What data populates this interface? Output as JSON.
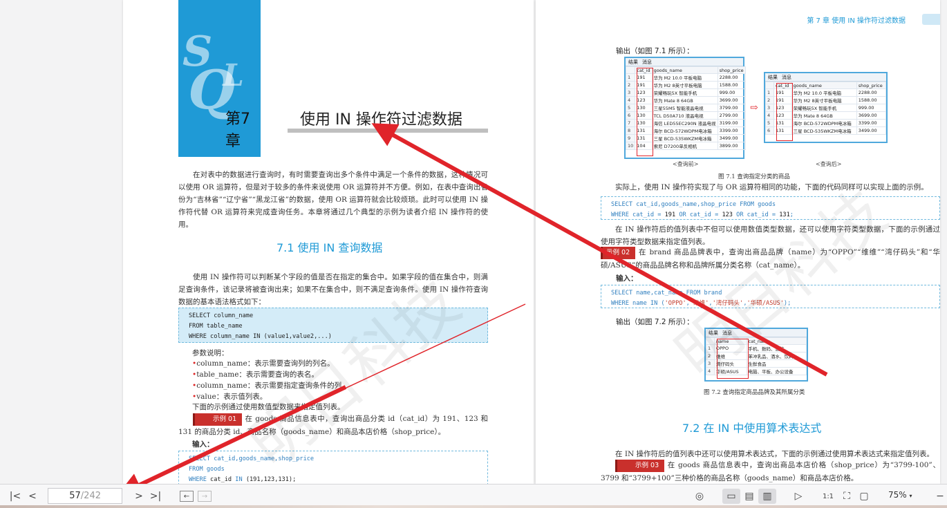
{
  "left_page": {
    "chapter_number": "第7章",
    "sql_letters": {
      "s": "S",
      "q": "Q",
      "l": "L"
    },
    "chapter_title": "使用 IN 操作符过滤数据",
    "intro": "在对表中的数据进行查询时，有时需要查询出多个条件中满足一个条件的数据，这种情况可以使用 OR 运算符，但是对于较多的条件来说使用 OR 运算符并不方便。例如，在表中查询出省份为“吉林省”“辽宁省”“黑龙江省”的数据，使用 OR 运算符就会比较烦琐。此时可以使用 IN 操作符代替 OR 运算符来完成查询任务。本章将通过几个典型的示例为读者介绍 IN 操作符的使用。",
    "section_title": "7.1  使用 IN 查询数据",
    "section_para": "使用 IN 操作符可以判断某个字段的值是否在指定的集合中。如果字段的值在集合中，则满足查询条件，该记录将被查询出来；如果不在集合中，则不满足查询条件。使用 IN 操作符查询数据的基本语法格式如下：",
    "syntax": [
      "SELECT column_name",
      "FROM table_name",
      "WHERE column_name IN (value1,value2,...)"
    ],
    "params_label": "参数说明：",
    "params": [
      "column_name：表示需要查询列的列名。",
      "table_name：表示需要查询的表名。",
      "column_name：表示需要指定查询条件的列。",
      "value：表示值列表。"
    ],
    "example_intro": "下面的示例通过使用数值型数据来指定值列表。",
    "example_tag": "示例 01",
    "example_text": "在 goods 商品信息表中，查询出商品分类 id（cat_id）为 191、123 和 131 的商品分类 id、商品名称（goods_name）和商品本店价格（shop_price）。",
    "input_label": "输入：",
    "code": {
      "l1_kw": "SELECT",
      "l1": " cat_id,goods_name,shop_price",
      "l2_kw": "FROM",
      "l2": " goods",
      "l3_kw": "WHERE",
      "l3a": " cat_id ",
      "l3_in": "IN",
      "l3b": " (191,123,131);"
    }
  },
  "right_page": {
    "running_head": "第 7 章    使用 IN 操作符过滤数据",
    "output_label_1": "输出（如图 7.1 所示）：",
    "tab_result": "结果",
    "tab_message": "消息",
    "table_before": {
      "headers": [
        "cat_id",
        "goods_name",
        "shop_price"
      ],
      "rows": [
        [
          "1",
          "191",
          "华为 M2 10.0 平板电脑",
          "2288.00"
        ],
        [
          "2",
          "191",
          "华为 M2 8英寸平板电脑",
          "1588.00"
        ],
        [
          "3",
          "123",
          "荣耀畅玩5X 智能手机",
          "999.00"
        ],
        [
          "4",
          "123",
          "华为 Mate 8 64GB",
          "3699.00"
        ],
        [
          "5",
          "130",
          "三星55M5 智能液晶电视",
          "3799.00"
        ],
        [
          "6",
          "130",
          "TCL D50A710 液晶电视",
          "2799.00"
        ],
        [
          "7",
          "130",
          "海信 LED55EC290N 液晶电视",
          "3199.00"
        ],
        [
          "8",
          "131",
          "海尔 BCD-572WDPM电冰箱",
          "3399.00"
        ],
        [
          "9",
          "131",
          "三星 BCD-535WKZM电冰箱",
          "3499.00"
        ],
        [
          "10",
          "104",
          "索尼 D7200单反相机",
          "3899.00"
        ]
      ]
    },
    "table_after": {
      "headers": [
        "cat_id",
        "goods_name",
        "shop_price"
      ],
      "rows": [
        [
          "1",
          "191",
          "华为 M2 10.0 平板电脑",
          "2288.00"
        ],
        [
          "2",
          "191",
          "华为 M2 8英寸平板电脑",
          "1588.00"
        ],
        [
          "3",
          "123",
          "荣耀畅玩5X 智能手机",
          "999.00"
        ],
        [
          "4",
          "123",
          "华为 Mate 8 64GB",
          "3699.00"
        ],
        [
          "5",
          "131",
          "海尔 BCD-572WDPM电冰箱",
          "3399.00"
        ],
        [
          "6",
          "131",
          "三星 BCD-535WKZM电冰箱",
          "3499.00"
        ]
      ]
    },
    "arrow": "⇨",
    "caption_before": "<查询前>",
    "caption_after": "<查询后>",
    "fig1_caption": "图 7.1    查询指定分类的商品",
    "para1": "实际上，使用 IN 操作符实现了与 OR 运算符相同的功能，下面的代码同样可以实现上面的示例。",
    "code1": {
      "kw1": "SELECT",
      "t1": " cat_id,goods_name,shop_price",
      "kw2": "FROM",
      "t2": " goods",
      "kw3": "WHERE",
      "t3a": " cat_id = ",
      "n1": "191",
      "or1": " OR ",
      "t3b": "cat_id = ",
      "n2": "123",
      "or2": " OR ",
      "t3c": "cat_id = ",
      "n3": "131",
      "end": ";"
    },
    "para2": "在 IN 操作符后的值列表中不但可以使用数值类型数据，还可以使用字符类型数据，下面的示例通过使用字符类型数据来指定值列表。",
    "example2_tag": "示例 02",
    "example2_text": "在 brand 商品品牌表中，查询出商品品牌（name）为“OPPO”“维维”“湾仔码头”和“华硕/ASUS”的商品品牌名称和品牌所属分类名称（cat_name）。",
    "input_label": "输入：",
    "code2": {
      "l1": "SELECT name,cat_name FROM brand",
      "l2a": "WHERE name IN (",
      "s1": "'OPPO'",
      "c1": ",",
      "s2": "'维维'",
      "c2": ",",
      "s3": "'湾仔码头'",
      "c3": ",",
      "s4": "'华硕/ASUS'",
      "l2b": ");"
    },
    "output_label_2": "输出（如图 7.2 所示）：",
    "table_brand": {
      "headers": [
        "name",
        "cat_name"
      ],
      "rows": [
        [
          "1",
          "OPPO",
          "手机、数码、通信"
        ],
        [
          "2",
          "维维",
          "苯冲乳品、酒水、饮料"
        ],
        [
          "3",
          "湾仔码头",
          "生鲜食品"
        ],
        [
          "4",
          "华硕/ASUS",
          "电脑、平板、办公设备"
        ]
      ]
    },
    "fig2_caption": "图 7.2    查询指定商品品牌及其所属分类",
    "section2_title": "7.2  在 IN 中使用算术表达式",
    "para3": "在 IN 操作符后的值列表中还可以使用算术表达式，下面的示例通过使用算术表达式来指定值列表。",
    "example3_tag": "示例 03",
    "example3_text": "在 goods 商品信息表中，查询出商品本店价格（shop_price）为“3799-100”、3799 和“3799+100”三种价格的商品名称（goods_name）和商品本店价格。"
  },
  "watermark": "明日科技",
  "toolbar": {
    "current_page": "57",
    "total_pages": "/242",
    "zoom": "75%"
  },
  "colors": {
    "accent": "#1f9ad6",
    "annotation_red": "#e0242a",
    "example_red": "#c9302c"
  }
}
